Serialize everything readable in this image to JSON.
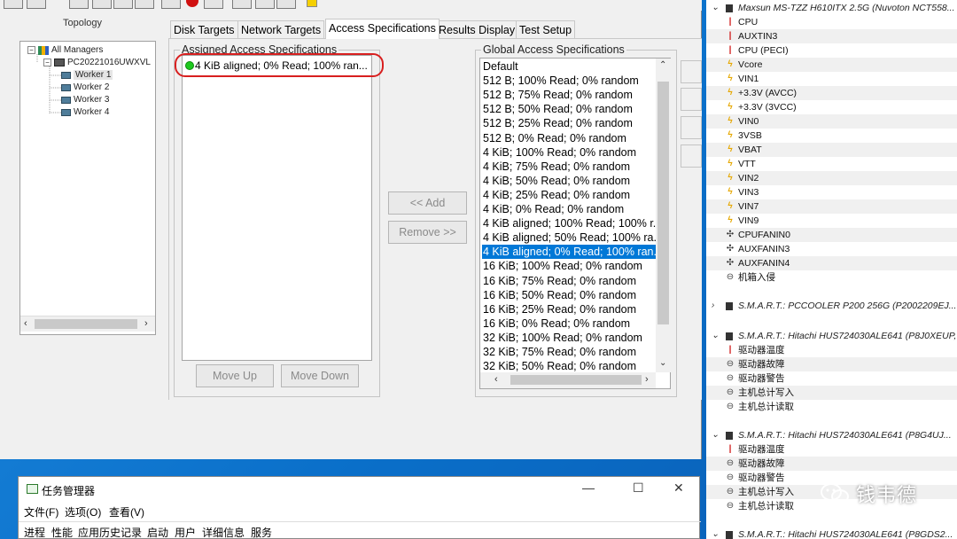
{
  "iometer": {
    "topology_label": "Topology",
    "tree": {
      "root": "All Managers",
      "manager": "PC20221016UWXVL",
      "workers": [
        "Worker 1",
        "Worker 2",
        "Worker 3",
        "Worker 4"
      ]
    },
    "tabs": [
      "Disk Targets",
      "Network Targets",
      "Access Specifications",
      "Results Display",
      "Test Setup"
    ],
    "active_tab": "Access Specifications",
    "assigned_label": "Assigned Access Specifications",
    "assigned_items": [
      "4 KiB aligned; 0% Read; 100% ran..."
    ],
    "global_label": "Global Access Specifications",
    "global_items": [
      "Default",
      "512 B; 100% Read; 0% random",
      "512 B; 75% Read; 0% random",
      "512 B; 50% Read; 0% random",
      "512 B; 25% Read; 0% random",
      "512 B; 0% Read; 0% random",
      "4 KiB; 100% Read; 0% random",
      "4 KiB; 75% Read; 0% random",
      "4 KiB; 50% Read; 0% random",
      "4 KiB; 25% Read; 0% random",
      "4 KiB; 0% Read; 0% random",
      "4 KiB aligned; 100% Read; 100% r...",
      "4 KiB aligned; 50% Read; 100% ra...",
      "4 KiB aligned; 0% Read; 100% ran...",
      "16 KiB; 100% Read; 0% random",
      "16 KiB; 75% Read; 0% random",
      "16 KiB; 50% Read; 0% random",
      "16 KiB; 25% Read; 0% random",
      "16 KiB; 0% Read; 0% random",
      "32 KiB; 100% Read; 0% random",
      "32 KiB; 75% Read; 0% random",
      "32 KiB; 50% Read; 0% random"
    ],
    "selected_global": "4 KiB aligned; 0% Read; 100% ran...",
    "buttons": {
      "add": "<< Add",
      "remove": "Remove >>",
      "move_up": "Move Up",
      "move_down": "Move Down"
    }
  },
  "hwinfo": {
    "board_title": "Maxsun MS-TZZ H610ITX 2.5G (Nuvoton NCT558...",
    "board_sensors": [
      {
        "label": "CPU",
        "icon": "thermometer-icon"
      },
      {
        "label": "AUXTIN3",
        "icon": "thermometer-icon"
      },
      {
        "label": "CPU (PECI)",
        "icon": "thermometer-icon"
      },
      {
        "label": "Vcore",
        "icon": "voltage-icon"
      },
      {
        "label": "VIN1",
        "icon": "voltage-icon"
      },
      {
        "label": "+3.3V (AVCC)",
        "icon": "voltage-icon"
      },
      {
        "label": "+3.3V (3VCC)",
        "icon": "voltage-icon"
      },
      {
        "label": "VIN0",
        "icon": "voltage-icon"
      },
      {
        "label": "3VSB",
        "icon": "voltage-icon"
      },
      {
        "label": "VBAT",
        "icon": "voltage-icon"
      },
      {
        "label": "VTT",
        "icon": "voltage-icon"
      },
      {
        "label": "VIN2",
        "icon": "voltage-icon"
      },
      {
        "label": "VIN3",
        "icon": "voltage-icon"
      },
      {
        "label": "VIN7",
        "icon": "voltage-icon"
      },
      {
        "label": "VIN9",
        "icon": "voltage-icon"
      },
      {
        "label": "CPUFANIN0",
        "icon": "fan-icon"
      },
      {
        "label": "AUXFANIN3",
        "icon": "fan-icon"
      },
      {
        "label": "AUXFANIN4",
        "icon": "fan-icon"
      },
      {
        "label": "机箱入侵",
        "icon": "clock-icon"
      }
    ],
    "smart_pccooler": "S.M.A.R.T.: PCCOOLER P200 256G (P2002209EJ...",
    "smart_hdd1": "S.M.A.R.T.: Hitachi HUS724030ALE641 (P8J0XEUP,",
    "smart_hdd1_sensors": [
      {
        "label": "驱动器温度",
        "icon": "thermometer-icon"
      },
      {
        "label": "驱动器故障",
        "icon": "clock-icon"
      },
      {
        "label": "驱动器警告",
        "icon": "clock-icon"
      },
      {
        "label": "主机总计写入",
        "icon": "clock-icon"
      },
      {
        "label": "主机总计读取",
        "icon": "clock-icon"
      }
    ],
    "smart_hdd2": "S.M.A.R.T.: Hitachi HUS724030ALE641 (P8G4UJ...",
    "smart_hdd2_sensors": [
      {
        "label": "驱动器温度",
        "icon": "thermometer-icon"
      },
      {
        "label": "驱动器故障",
        "icon": "clock-icon"
      },
      {
        "label": "驱动器警告",
        "icon": "clock-icon"
      },
      {
        "label": "主机总计写入",
        "icon": "clock-icon"
      },
      {
        "label": "主机总计读取",
        "icon": "clock-icon"
      }
    ],
    "smart_hdd3": "S.M.A.R.T.: Hitachi HUS724030ALE641 (P8GDS2..."
  },
  "taskmgr": {
    "title": "任务管理器",
    "menu": [
      "文件(F)",
      "选项(O)",
      "查看(V)"
    ],
    "tabs": [
      "进程",
      "性能",
      "应用历史记录",
      "启动",
      "用户",
      "详细信息",
      "服务"
    ],
    "minimize": "—",
    "maximize": "☐",
    "close": "✕"
  },
  "watermark": {
    "text": "钱韦德"
  },
  "colors": {
    "desktop": "#0a78d4",
    "selection": "#0078d7",
    "highlight_oval": "#d81f1f",
    "green_dot": "#1ec81e"
  }
}
